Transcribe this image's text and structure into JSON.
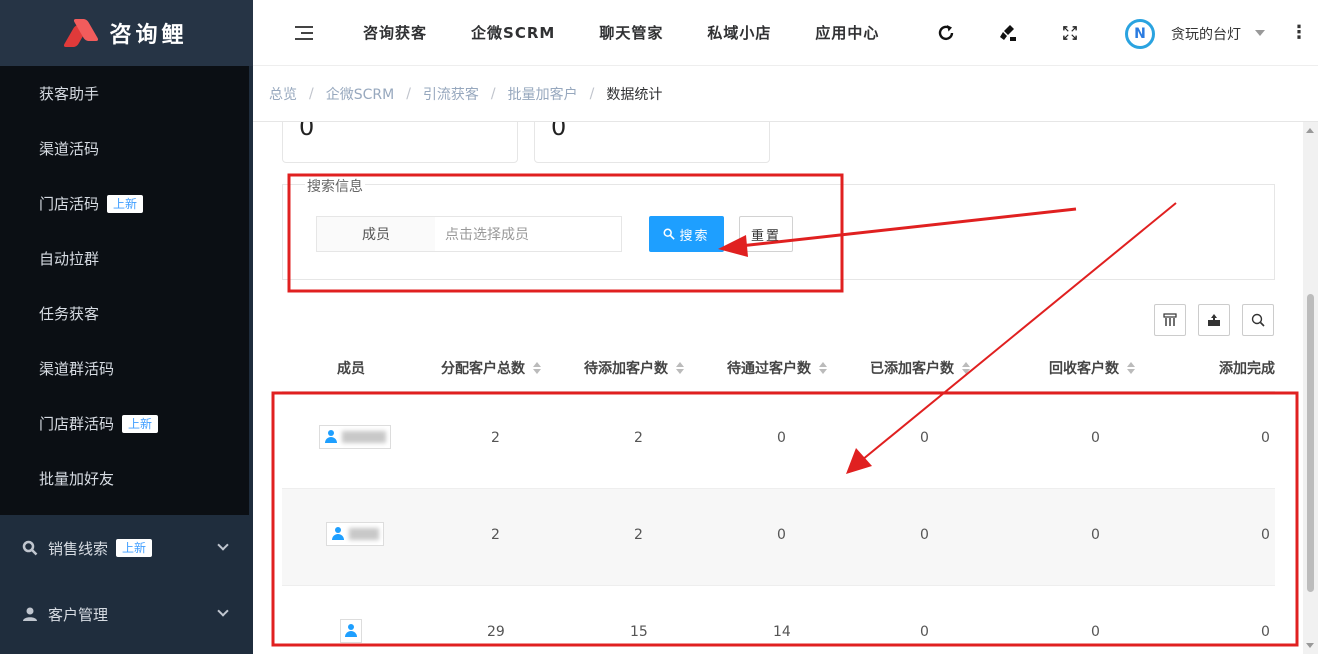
{
  "brand": {
    "name": "咨询鲤"
  },
  "sidebar": {
    "sub_items": [
      {
        "label": "获客助手",
        "badge": ""
      },
      {
        "label": "渠道活码",
        "badge": ""
      },
      {
        "label": "门店活码",
        "badge": "上新"
      },
      {
        "label": "自动拉群",
        "badge": ""
      },
      {
        "label": "任务获客",
        "badge": ""
      },
      {
        "label": "渠道群活码",
        "badge": ""
      },
      {
        "label": "门店群活码",
        "badge": "上新"
      },
      {
        "label": "批量加好友",
        "badge": ""
      }
    ],
    "menus": [
      {
        "label": "销售线索",
        "badge": "上新",
        "icon": "search-icon"
      },
      {
        "label": "客户管理",
        "badge": "",
        "icon": "user-icon"
      }
    ]
  },
  "topnav": {
    "items": [
      "咨询获客",
      "企微SCRM",
      "聊天管家",
      "私域小店",
      "应用中心"
    ],
    "tools": [
      "refresh-icon",
      "brush-icon",
      "fullscreen-icon"
    ],
    "username": "贪玩的台灯",
    "avatar_letter": "N"
  },
  "breadcrumb": [
    "总览",
    "企微SCRM",
    "引流获客",
    "批量加客户",
    "数据统计"
  ],
  "stats": [
    "0",
    "0"
  ],
  "search": {
    "legend": "搜索信息",
    "member_label": "成员",
    "member_placeholder": "点击选择成员",
    "search_button": "搜索",
    "reset_button": "重置"
  },
  "table": {
    "tools": [
      "columns-icon",
      "export-icon",
      "search-icon"
    ],
    "headers": [
      "成员",
      "分配客户总数",
      "待添加客户数",
      "待通过客户数",
      "已添加客户数",
      "回收客户数",
      "添加完成"
    ],
    "rows": [
      [
        "2",
        "2",
        "0",
        "0",
        "0",
        "0"
      ],
      [
        "2",
        "2",
        "0",
        "0",
        "0",
        "0"
      ],
      [
        "29",
        "15",
        "14",
        "0",
        "0",
        "0"
      ]
    ]
  },
  "colors": {
    "sidebar": "#1f2d3d",
    "submenu": "#0b0f14",
    "primary": "#1e9fff",
    "annotation": "#e02020"
  }
}
